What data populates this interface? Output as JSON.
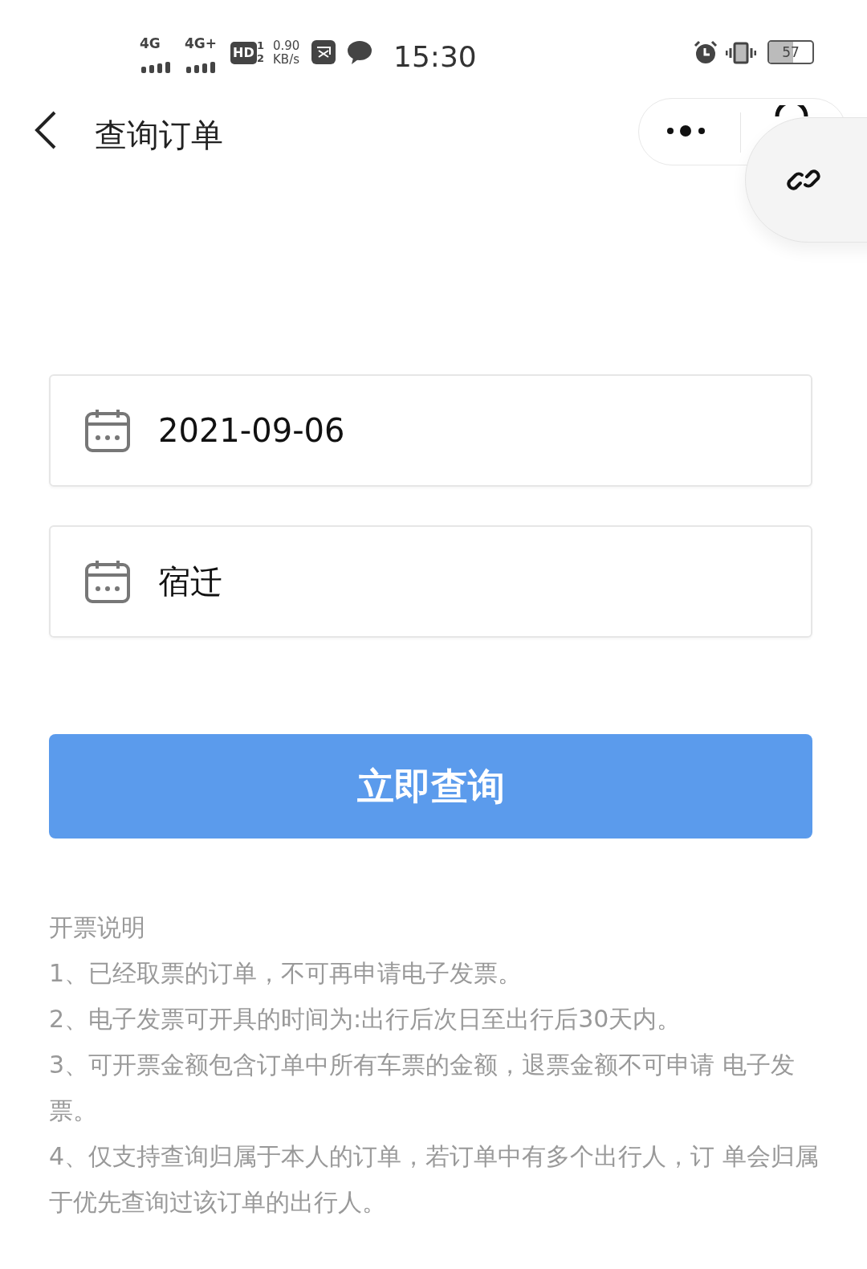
{
  "status_bar": {
    "network_1": "4G",
    "network_2": "4G+",
    "hd": "HD",
    "sim_1": "1",
    "sim_2": "2",
    "speed": "0.90",
    "speed_unit": "KB/s",
    "time": "15:30",
    "battery": "57"
  },
  "nav": {
    "title": "查询订单"
  },
  "fields": [
    {
      "kind": "date",
      "value": "2021-09-06"
    },
    {
      "kind": "date",
      "value": "宿迁"
    }
  ],
  "submit_button": "立即查询",
  "notes": {
    "title": "开票说明",
    "items": [
      "1、已经取票的订单，不可再申请电子发票。",
      "2、电子发票可开具的时间为:出行后次日至出行后30天内。",
      "3、可开票金额包含订单中所有车票的金额，退票金额不可申请 电子发票。",
      "4、仅支持查询归属于本人的订单，若订单中有多个出行人，订 单会归属于优先查询过该订单的出行人。"
    ]
  }
}
